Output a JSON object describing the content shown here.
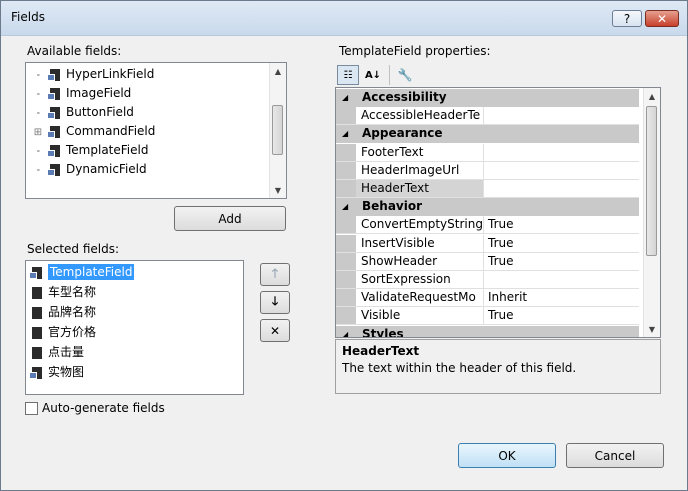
{
  "window": {
    "title": "Fields",
    "help_label": "?",
    "close_label": "✕"
  },
  "available": {
    "label": "Available fields:",
    "items": [
      {
        "label": "HyperLinkField",
        "icon": "hyperlink-field-icon"
      },
      {
        "label": "ImageField",
        "icon": "image-field-icon"
      },
      {
        "label": "ButtonField",
        "icon": "button-field-icon"
      },
      {
        "label": "CommandField",
        "icon": "command-field-icon",
        "expander": "+"
      },
      {
        "label": "TemplateField",
        "icon": "template-field-icon"
      },
      {
        "label": "DynamicField",
        "icon": "dynamic-field-icon"
      }
    ]
  },
  "add_button": "Add",
  "selected": {
    "label": "Selected fields:",
    "items": [
      {
        "label": "TemplateField",
        "icon": "template-field-icon",
        "selected": true
      },
      {
        "label": "车型名称",
        "icon": "bound-field-icon"
      },
      {
        "label": "品牌名称",
        "icon": "bound-field-icon"
      },
      {
        "label": "官方价格",
        "icon": "bound-field-icon"
      },
      {
        "label": "点击量",
        "icon": "bound-field-icon"
      },
      {
        "label": "实物图",
        "icon": "image-field-icon"
      }
    ]
  },
  "move_buttons": {
    "up": "🡑",
    "down": "🡓",
    "delete": "✕"
  },
  "autogen": {
    "label": "Auto-generate fields",
    "checked": false
  },
  "properties": {
    "label": "TemplateField properties:",
    "rows": [
      {
        "type": "category",
        "name": "Accessibility",
        "toggle": "◢"
      },
      {
        "type": "prop",
        "name": "AccessibleHeaderTe",
        "value": ""
      },
      {
        "type": "category",
        "name": "Appearance",
        "toggle": "◢"
      },
      {
        "type": "prop",
        "name": "FooterText",
        "value": ""
      },
      {
        "type": "prop",
        "name": "HeaderImageUrl",
        "value": ""
      },
      {
        "type": "prop",
        "name": "HeaderText",
        "value": "",
        "highlight": true
      },
      {
        "type": "category",
        "name": "Behavior",
        "toggle": "◢"
      },
      {
        "type": "prop",
        "name": "ConvertEmptyString",
        "value": "True"
      },
      {
        "type": "prop",
        "name": "InsertVisible",
        "value": "True"
      },
      {
        "type": "prop",
        "name": "ShowHeader",
        "value": "True"
      },
      {
        "type": "prop",
        "name": "SortExpression",
        "value": ""
      },
      {
        "type": "prop",
        "name": "ValidateRequestMo",
        "value": "Inherit"
      },
      {
        "type": "prop",
        "name": "Visible",
        "value": "True"
      },
      {
        "type": "category",
        "name": "Styles",
        "toggle": "◢"
      }
    ],
    "description_title": "HeaderText",
    "description_text": "The text within the header of this field."
  },
  "ok_button": "OK",
  "cancel_button": "Cancel"
}
